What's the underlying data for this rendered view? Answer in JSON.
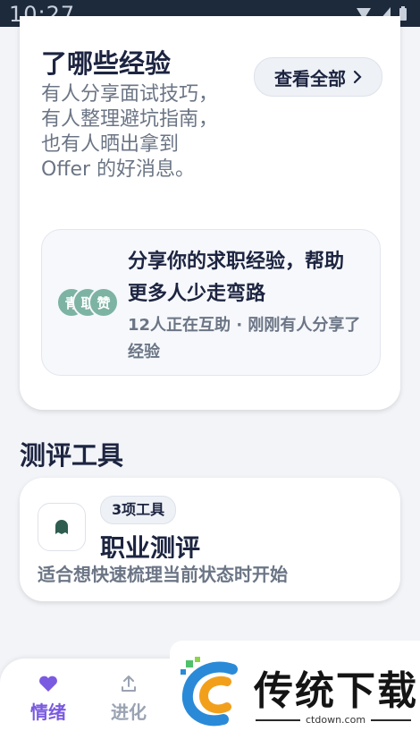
{
  "status_bar": {
    "time": "10:27"
  },
  "experience_card": {
    "title": "了哪些经验",
    "description": "有人分享面试技巧，有人整理避坑指南，也有人晒出拿到 Offer 的好消息。",
    "view_all_label": "查看全部",
    "share_box": {
      "avatars": [
        "青",
        "取",
        "赞"
      ],
      "title": "分享你的求职经验，帮助更多人少走弯路",
      "subtitle": "12人正在互助 · 刚刚有人分享了经验"
    }
  },
  "tools_section": {
    "title": "测评工具",
    "card": {
      "badge": "3项工具",
      "name": "职业测评",
      "description": "适合想快速梳理当前状态时开始"
    }
  },
  "bottom_nav": {
    "items": [
      {
        "label": "情绪",
        "icon": "heart-icon",
        "color": "#7a5ae0"
      },
      {
        "label": "进化",
        "icon": "upload-icon",
        "color": "#9aa3b2"
      }
    ]
  },
  "watermark": {
    "name": "传统下载",
    "url": "ctdown.com"
  },
  "colors": {
    "accent": "#7a5ae0",
    "avatar": "#7db3a3",
    "tool_icon": "#2f5d50"
  }
}
